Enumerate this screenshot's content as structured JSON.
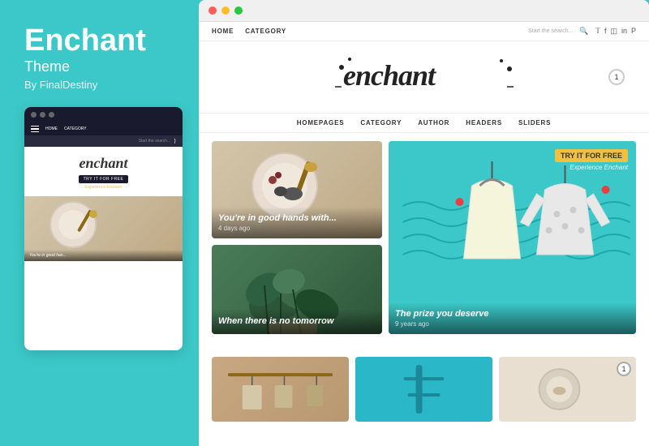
{
  "sidebar": {
    "title": "Enchant",
    "subtitle": "Theme",
    "author": "By FinalDestiny",
    "mini_preview": {
      "nav_links": [
        "HOME",
        "CATEGORY"
      ],
      "search_placeholder": "Start the search...",
      "logo_text": "enchant",
      "try_btn": "TRY IT FOR FREE",
      "experience_text": "Experience Enchant",
      "bottom_img_text": "You're in good han..."
    }
  },
  "main": {
    "browser_dots": [
      "red",
      "yellow",
      "green"
    ],
    "site": {
      "nav_links": [
        "HOME",
        "CATEGORY"
      ],
      "search_placeholder": "Start the search...",
      "social_icons": [
        "twitter",
        "facebook",
        "linkedin",
        "instagram",
        "pinterest"
      ],
      "logo_text": "enchant",
      "notification_badge": "1",
      "secondary_nav": [
        "HOMEPAGES",
        "CATEGORY",
        "AUTHOR",
        "HEADERS",
        "SLIDERS"
      ],
      "blog_posts": [
        {
          "title": "You're in good hands with...",
          "date": "4 days ago",
          "bg_type": "honey"
        },
        {
          "title": "When there is no tomorrow",
          "date": "",
          "bg_type": "green"
        },
        {
          "title": "The prize you deserve",
          "date": "9 years ago",
          "bg_type": "teal",
          "badge_try": "TRY IT FOR FREE",
          "badge_experience": "Experience Enchant"
        }
      ],
      "bottom_posts": [
        {
          "bg_type": "wood",
          "badge": ""
        },
        {
          "bg_type": "teal2",
          "badge": ""
        },
        {
          "bg_type": "cream",
          "badge": "1"
        }
      ]
    }
  }
}
